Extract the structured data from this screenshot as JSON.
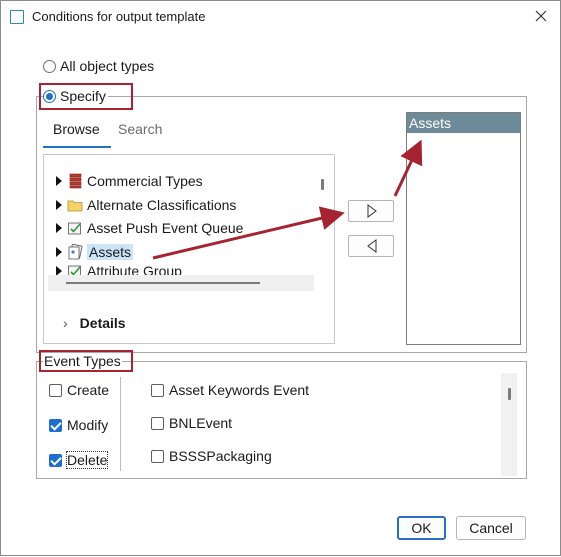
{
  "window": {
    "title": "Conditions for output template"
  },
  "scope": {
    "all_label": "All object types",
    "specify_label": "Specify",
    "selected": "specify"
  },
  "browser": {
    "tabs": [
      "Browse",
      "Search"
    ],
    "active_tab": "Browse",
    "tree_items": [
      {
        "label": "Commercial Types",
        "icon": "red-stack-icon",
        "selected": false
      },
      {
        "label": "Alternate Classifications",
        "icon": "folder-icon",
        "selected": false
      },
      {
        "label": "Asset Push Event Queue",
        "icon": "event-queue-icon",
        "selected": false
      },
      {
        "label": "Assets",
        "icon": "asset-icon",
        "selected": true
      },
      {
        "label": "Attribute Group",
        "icon": "event-queue-icon",
        "selected": false
      }
    ],
    "details_label": "Details"
  },
  "selected_types": {
    "items": [
      "Assets"
    ]
  },
  "event_types": {
    "title": "Event Types",
    "actions": [
      {
        "label": "Create",
        "checked": false
      },
      {
        "label": "Modify",
        "checked": true
      },
      {
        "label": "Delete",
        "checked": true
      }
    ],
    "events": [
      {
        "label": "Asset Keywords Event",
        "checked": false
      },
      {
        "label": "BNLEvent",
        "checked": false
      },
      {
        "label": "BSSSPackaging",
        "checked": false
      }
    ]
  },
  "footer": {
    "ok_label": "OK",
    "cancel_label": "Cancel"
  },
  "colors": {
    "accent": "#1c6fd1",
    "annotation_red": "#a82331",
    "list_header": "#6d8a98",
    "selection": "#cce4f7"
  }
}
